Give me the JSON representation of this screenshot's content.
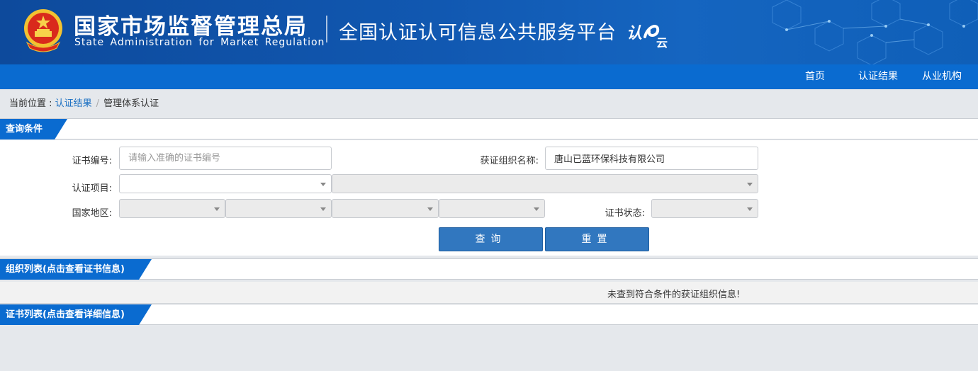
{
  "header": {
    "org_name_cn": "国家市场监督管理总局",
    "org_name_en": "State Administration  for  Market Regulation",
    "platform_title": "全国认证认可信息公共服务平台",
    "brand_logo_text": "认e云",
    "emblem_icon": "national-emblem-icon",
    "banner_color": "#1158b1"
  },
  "nav": {
    "items": [
      {
        "label": "首页"
      },
      {
        "label": "认证结果"
      },
      {
        "label": "从业机构"
      }
    ],
    "color": "#0a6bd0"
  },
  "breadcrumb": {
    "prefix": "当前位置 : ",
    "link": "认证结果",
    "separator": "/",
    "current": "管理体系认证"
  },
  "query_section": {
    "title": "查询条件",
    "cert_no_label": "证书编号:",
    "cert_no_placeholder": "请输入准确的证书编号",
    "cert_no_value": "",
    "org_name_label": "获证组织名称:",
    "org_name_value": "唐山已蓝环保科技有限公司",
    "project_label": "认证项目:",
    "region_label": "国家地区:",
    "status_label": "证书状态:",
    "search_button": "查询",
    "reset_button": "重置",
    "button_color": "#3177bf"
  },
  "org_list_section": {
    "title": "组织列表(点击查看证书信息)",
    "empty_message": "未查到符合条件的获证组织信息!"
  },
  "cert_list_section": {
    "title": "证书列表(点击查看详细信息)"
  }
}
